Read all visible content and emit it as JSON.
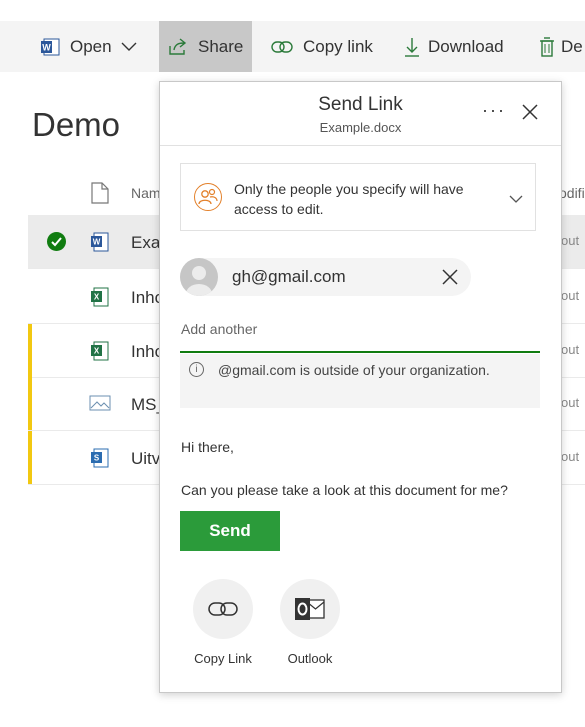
{
  "toolbar": {
    "open_label": "Open",
    "share_label": "Share",
    "copy_link_label": "Copy link",
    "download_label": "Download",
    "delete_label": "De"
  },
  "library": {
    "title": "Demo",
    "name_header": "Nam",
    "modified_header": "odifi",
    "rows": [
      {
        "name": "Exan",
        "modified": "out",
        "type": "word",
        "selected": true,
        "flag": false
      },
      {
        "name": "Inho",
        "modified": "out",
        "type": "excel",
        "selected": false,
        "flag": false
      },
      {
        "name": "Inho",
        "modified": "out",
        "type": "excel",
        "selected": false,
        "flag": true
      },
      {
        "name": "MS_",
        "modified": "out",
        "type": "image",
        "selected": false,
        "flag": true
      },
      {
        "name": "Uitv",
        "modified": "out",
        "type": "sway",
        "selected": false,
        "flag": true
      }
    ]
  },
  "dialog": {
    "title": "Send Link",
    "subtitle": "Example.docx",
    "more_label": "···",
    "permission_text": "Only the people you specify will have access to edit.",
    "recipient_email": "gh@gmail.com",
    "add_placeholder": "Add another",
    "warning_text": "@gmail.com is outside of your organization.",
    "message_line1": "Hi there,",
    "message_line2": "Can you please take a look at this document for me?",
    "send_label": "Send",
    "copy_link_label": "Copy Link",
    "outlook_label": "Outlook"
  },
  "colors": {
    "send_green": "#2b9b3a",
    "field_underline": "#107c10",
    "people_icon": "#e3802a",
    "flag_yellow": "#f2c811",
    "word_blue": "#2b579a",
    "excel_green": "#217346"
  }
}
